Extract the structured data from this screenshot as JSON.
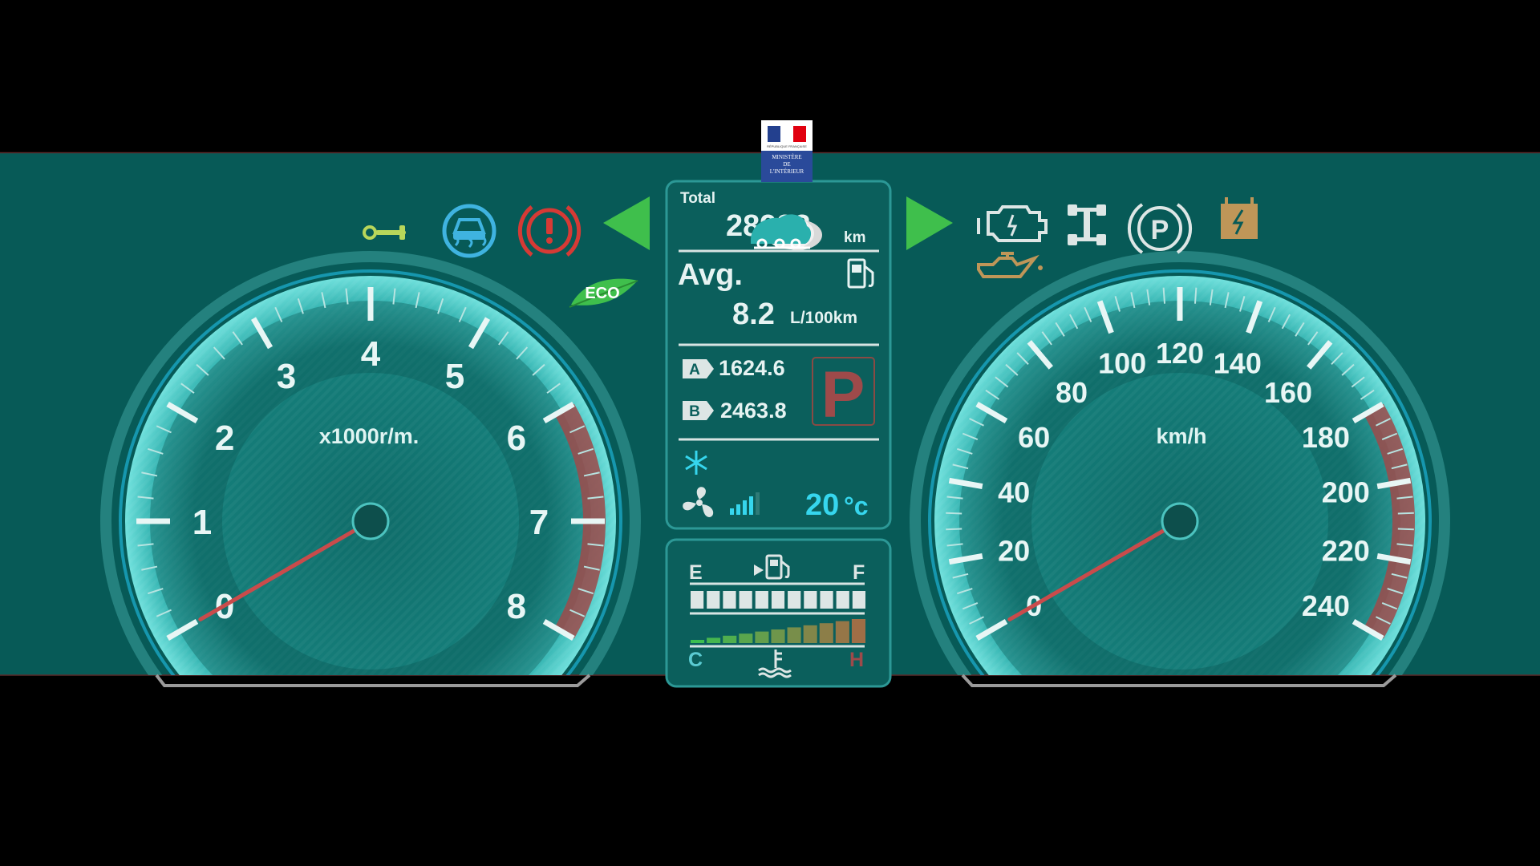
{
  "colors": {
    "panel": "#075a57",
    "accent": "#36d6ee",
    "redline": "#9e4a4a",
    "needle": "#c94b4b",
    "green_arrow": "#3fbf4c",
    "warning_red": "#d63a35",
    "amber": "#bf9658"
  },
  "ministry": {
    "line1": "MINISTÈRE",
    "line2": "DE",
    "line3": "L'INTÉRIEUR",
    "republique": "RÉPUBLIQUE FRANÇAISE"
  },
  "tachometer": {
    "unit": "x1000r/m.",
    "ticks": [
      "0",
      "1",
      "2",
      "3",
      "4",
      "5",
      "6",
      "7",
      "8"
    ],
    "min": 0,
    "max": 8,
    "redline_from": 6,
    "value": 0
  },
  "speedometer": {
    "unit": "km/h",
    "ticks": [
      "0",
      "20",
      "40",
      "60",
      "80",
      "100",
      "120",
      "140",
      "160",
      "180",
      "200",
      "220",
      "240"
    ],
    "min": 0,
    "max": 240,
    "redline_from": 180,
    "value": 0
  },
  "info": {
    "total_label": "Total",
    "total_value": "28993",
    "total_unit": "km",
    "avg_label": "Avg.",
    "avg_value": "8.2",
    "avg_unit": "L/100km",
    "trip_a_label": "A",
    "trip_a_value": "1624.6",
    "trip_b_label": "B",
    "trip_b_value": "2463.8",
    "gear": "P",
    "temperature": "20",
    "temperature_unit": "°c",
    "fan_level": 4,
    "fan_level_max": 5
  },
  "gauges": {
    "fuel_empty_label": "E",
    "fuel_full_label": "F",
    "fuel_level": 1.0,
    "fuel_segments": 11,
    "temp_cold_label": "C",
    "temp_hot_label": "H",
    "coolant_level": 1.0,
    "coolant_segments": 11
  },
  "indicators": {
    "eco_label": "ECO",
    "left_icons": [
      "wrench-icon",
      "traction-control-icon",
      "brake-warning-icon",
      "eco-leaf-icon",
      "turn-left-icon"
    ],
    "right_icons": [
      "turn-right-icon",
      "check-engine-icon",
      "oil-pressure-icon",
      "differential-lock-icon",
      "parking-brake-icon",
      "battery-icon"
    ],
    "parking_brake_letter": "P"
  }
}
